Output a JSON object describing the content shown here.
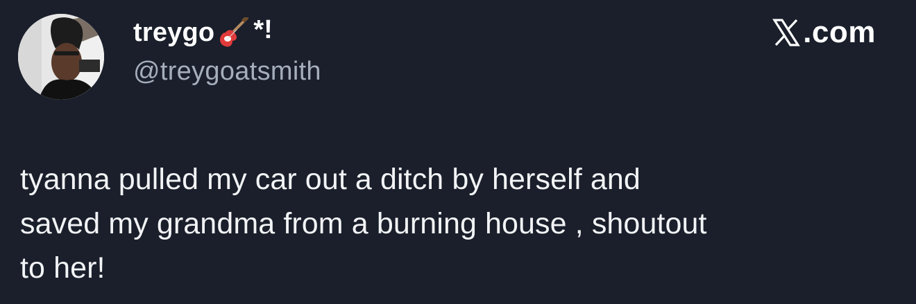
{
  "author": {
    "display_name": "treygo",
    "display_emoji_icon": "electric-guitar-icon",
    "display_suffix": "*!",
    "handle": "@treygoatsmith",
    "avatar_icon": "profile-photo"
  },
  "platform": {
    "logo_icon": "x-logo-icon",
    "text": ".com"
  },
  "tweet": {
    "text": "tyanna pulled my car out a ditch by herself and\nsaved my grandma from a burning house , shoutout\nto her!"
  },
  "colors": {
    "background": "#1a1f2b",
    "text": "#ffffff",
    "handle": "#a6aebb"
  }
}
